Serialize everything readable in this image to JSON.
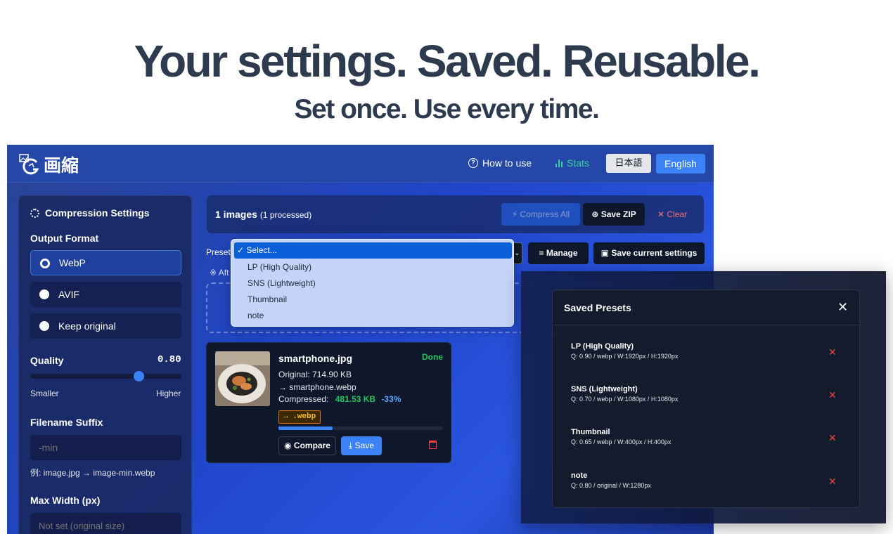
{
  "hero": {
    "title": "Your settings. Saved. Reusable.",
    "subtitle": "Set once. Use every time."
  },
  "app": {
    "logo_text": "画縮",
    "nav": {
      "how_to_use": "How to use",
      "stats": "Stats",
      "lang_ja": "日本語",
      "lang_en": "English"
    },
    "sidebar": {
      "title": "Compression Settings",
      "output_format_label": "Output Format",
      "formats": [
        {
          "label": "WebP",
          "selected": true
        },
        {
          "label": "AVIF",
          "selected": false
        },
        {
          "label": "Keep original",
          "selected": false
        }
      ],
      "quality_label": "Quality",
      "quality_value": "0.80",
      "quality_fraction": 0.8,
      "quality_min_label": "Smaller",
      "quality_max_label": "Higher",
      "suffix_label": "Filename Suffix",
      "suffix_placeholder": "-min",
      "suffix_example": "例: image.jpg → image-min.webp",
      "max_width_label": "Max Width (px)",
      "max_width_placeholder": "Not set (original size)"
    },
    "header": {
      "images_count": "1 images",
      "processed": "(1 processed)",
      "compress_all": "Compress All",
      "save_zip": "Save ZIP",
      "clear": "Clear"
    },
    "preset_bar": {
      "label": "Preset",
      "manage": "Manage",
      "save_current": "Save current settings",
      "note_prefix": "※ Aft"
    },
    "dropdown": {
      "options": [
        {
          "label": "Select...",
          "selected": true
        },
        {
          "label": "LP (High Quality)",
          "selected": false
        },
        {
          "label": "SNS (Lightweight)",
          "selected": false
        },
        {
          "label": "Thumbnail",
          "selected": false
        },
        {
          "label": "note",
          "selected": false
        }
      ]
    },
    "card": {
      "filename": "smartphone.jpg",
      "status": "Done",
      "original": "Original: 714.90 KB",
      "target": "→ smartphone.webp",
      "compressed_label": "Compressed:",
      "compressed_size": "481.53 KB",
      "reduction": "-33%",
      "format_badge": "→ .webp",
      "progress_fraction": 0.33,
      "compare": "Compare",
      "save": "Save"
    }
  },
  "modal": {
    "title": "Saved Presets",
    "presets": [
      {
        "name": "LP (High Quality)",
        "desc": "Q: 0.90 / webp / W:1920px / H:1920px"
      },
      {
        "name": "SNS (Lightweight)",
        "desc": "Q: 0.70 / webp / W:1080px / H:1080px"
      },
      {
        "name": "Thumbnail",
        "desc": "Q: 0.65 / webp / W:400px / H:400px"
      },
      {
        "name": "note",
        "desc": "Q: 0.80 / original / W:1280px"
      }
    ]
  },
  "colors": {
    "accent": "#3b82f6",
    "success": "#22c55e",
    "danger": "#ef4444",
    "heading": "#2e3a4d"
  }
}
